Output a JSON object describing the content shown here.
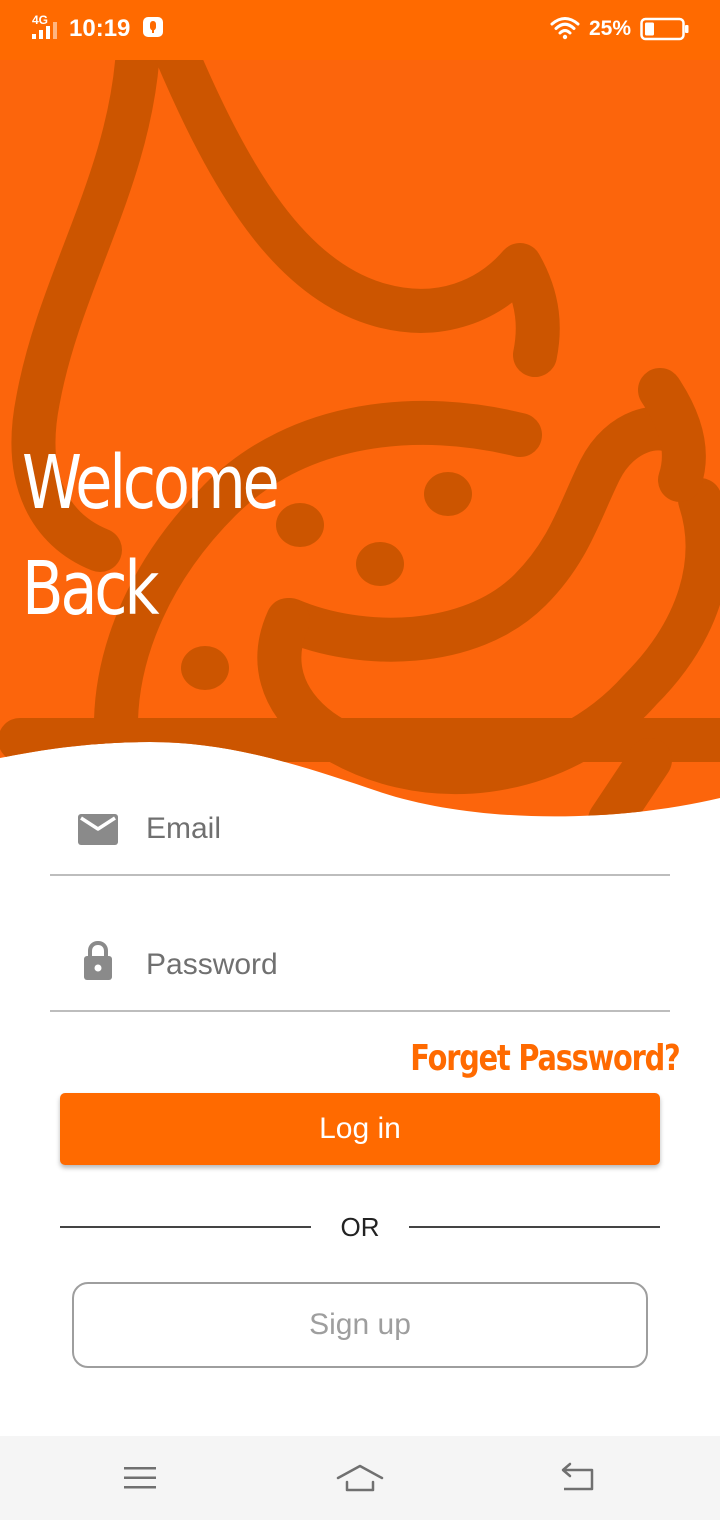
{
  "status_bar": {
    "network": "4G",
    "time": "10:19",
    "battery_percent": "25%",
    "icons": [
      "signal-4g-icon",
      "notification-shield-icon",
      "wifi-icon",
      "battery-icon"
    ]
  },
  "hero": {
    "title_line1": "Welcome",
    "title_line2": "Back"
  },
  "form": {
    "email": {
      "placeholder": "Email",
      "value": "",
      "icon": "mail-icon"
    },
    "password": {
      "placeholder": "Password",
      "value": "",
      "icon": "lock-icon"
    },
    "forgot_label": "Forget Password?",
    "login_label": "Log in",
    "or_label": "OR",
    "signup_label": "Sign up"
  },
  "nav_bar": {
    "icons": [
      "menu-icon",
      "home-icon",
      "back-icon"
    ]
  },
  "colors": {
    "accent": "#ff6a00",
    "hero_pattern": "#cc5500",
    "nav_background": "#f5f5f5"
  }
}
